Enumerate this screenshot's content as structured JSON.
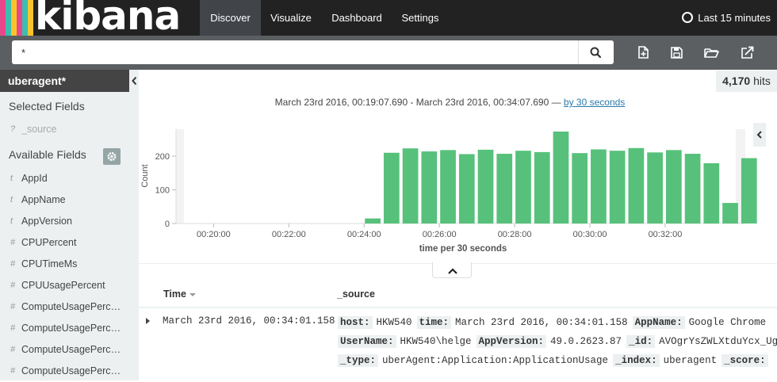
{
  "brand": {
    "name": "kibana",
    "stripe_colors": [
      "#e8488b",
      "#3cbeb1",
      "#f8c42b",
      "#e8488b",
      "#3cbeb1",
      "#f8c42b"
    ]
  },
  "nav": {
    "items": [
      {
        "label": "Discover",
        "active": true
      },
      {
        "label": "Visualize",
        "active": false
      },
      {
        "label": "Dashboard",
        "active": false
      },
      {
        "label": "Settings",
        "active": false
      }
    ],
    "time_picker": {
      "label": "Last 15 minutes",
      "icon": "clock-icon"
    }
  },
  "search": {
    "query": "*",
    "button_icon": "search-icon",
    "toolbar_icons": [
      "new-search-icon",
      "save-icon",
      "open-icon",
      "share-icon"
    ]
  },
  "sidebar": {
    "index_pattern": "uberagent*",
    "selected_fields_heading": "Selected Fields",
    "selected_fields": [
      {
        "type": "?",
        "name": "_source"
      }
    ],
    "available_fields_heading": "Available Fields",
    "available_fields": [
      {
        "type": "t",
        "name": "AppId"
      },
      {
        "type": "t",
        "name": "AppName"
      },
      {
        "type": "t",
        "name": "AppVersion"
      },
      {
        "type": "#",
        "name": "CPUPercent"
      },
      {
        "type": "#",
        "name": "CPUTimeMs"
      },
      {
        "type": "#",
        "name": "CPUUsagePercent"
      },
      {
        "type": "#",
        "name": "ComputeUsagePercen..."
      },
      {
        "type": "#",
        "name": "ComputeUsagePercen..."
      },
      {
        "type": "#",
        "name": "ComputeUsagePercen..."
      },
      {
        "type": "#",
        "name": "ComputeUsagePercen..."
      }
    ]
  },
  "hits": {
    "count": "4,170",
    "label": "hits"
  },
  "time_range": {
    "text": "March 23rd 2016, 00:19:07.690 - March 23rd 2016, 00:34:07.690 — ",
    "interval_link": "by 30 seconds"
  },
  "chart_data": {
    "type": "bar",
    "xlabel": "time per 30 seconds",
    "ylabel": "Count",
    "ylim": [
      0,
      280
    ],
    "yticks": [
      0,
      100,
      200
    ],
    "xticks": [
      "00:20:00",
      "00:22:00",
      "00:24:00",
      "00:26:00",
      "00:28:00",
      "00:30:00",
      "00:32:00"
    ],
    "bar_color": "#57c17b",
    "categories": [
      "00:24:00",
      "00:24:30",
      "00:25:00",
      "00:25:30",
      "00:26:00",
      "00:26:30",
      "00:27:00",
      "00:27:30",
      "00:28:00",
      "00:28:30",
      "00:29:00",
      "00:29:30",
      "00:30:00",
      "00:30:30",
      "00:31:00",
      "00:31:30",
      "00:32:00",
      "00:32:30",
      "00:33:00",
      "00:33:30",
      "00:34:00"
    ],
    "values": [
      15,
      210,
      223,
      214,
      218,
      206,
      219,
      207,
      216,
      212,
      273,
      209,
      220,
      216,
      224,
      211,
      218,
      207,
      179,
      61,
      194
    ]
  },
  "table": {
    "columns": [
      "Time",
      "_source"
    ],
    "rows": [
      {
        "time": "March 23rd 2016, 00:34:01.158",
        "source_lines": [
          [
            [
              "host:",
              "HKW540"
            ],
            [
              "time:",
              "March 23rd 2016, 00:34:01.158"
            ],
            [
              "AppName:",
              "Google Chrome"
            ]
          ],
          [
            [
              "UserName:",
              "HKW540\\helge"
            ],
            [
              "AppVersion:",
              "49.0.2623.87"
            ],
            [
              "_id:",
              "AVOgrYsZWLXtduYcx_Ug"
            ]
          ],
          [
            [
              "_type:",
              "uberAgent:Application:ApplicationUsage"
            ],
            [
              "_index:",
              "uberagent"
            ],
            [
              "_score:",
              ""
            ]
          ]
        ]
      }
    ]
  }
}
